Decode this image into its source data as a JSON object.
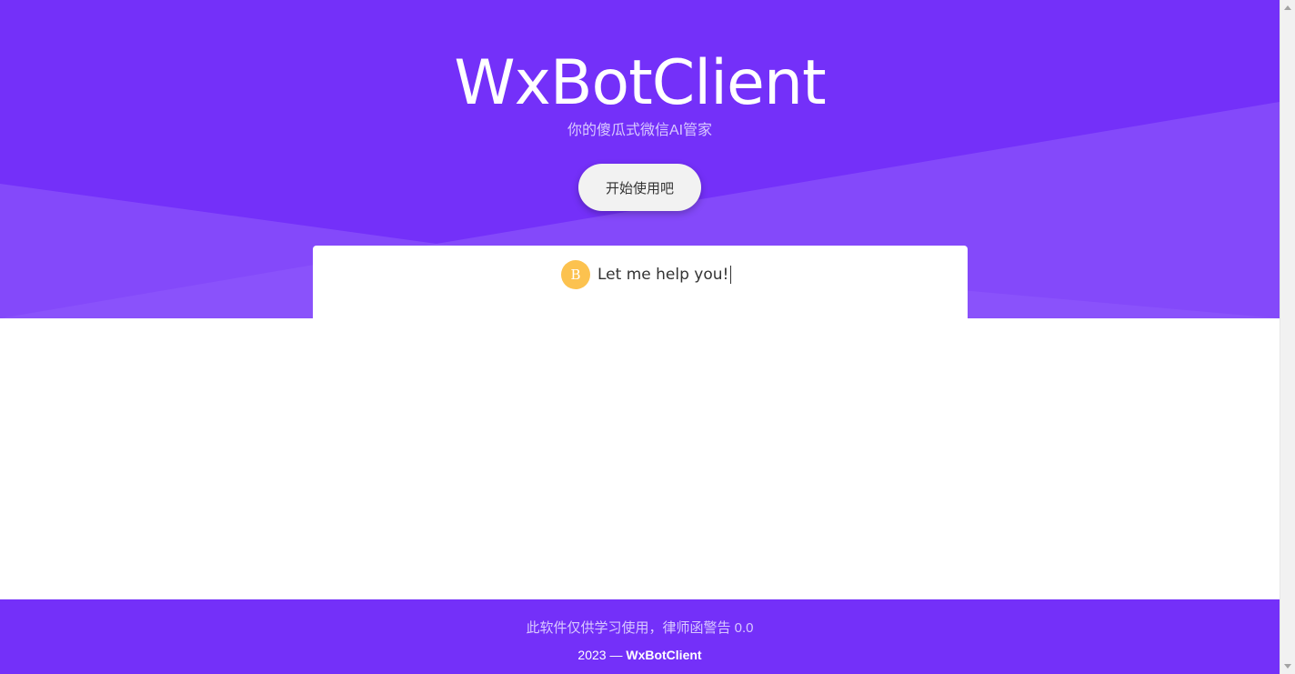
{
  "hero": {
    "title": "WxBotClient",
    "subtitle": "你的傻瓜式微信AI管家",
    "cta_label": "开始使用吧"
  },
  "chat": {
    "avatar_letter": "B",
    "message": "Let me help you!"
  },
  "footer": {
    "notice": "此软件仅供学习使用，律师函警告 0.0",
    "year_prefix": "2023 — ",
    "brand": "WxBotClient"
  },
  "colors": {
    "primary": "#7430f9",
    "primary_light": "#8449fa",
    "avatar": "#fcc24f"
  }
}
